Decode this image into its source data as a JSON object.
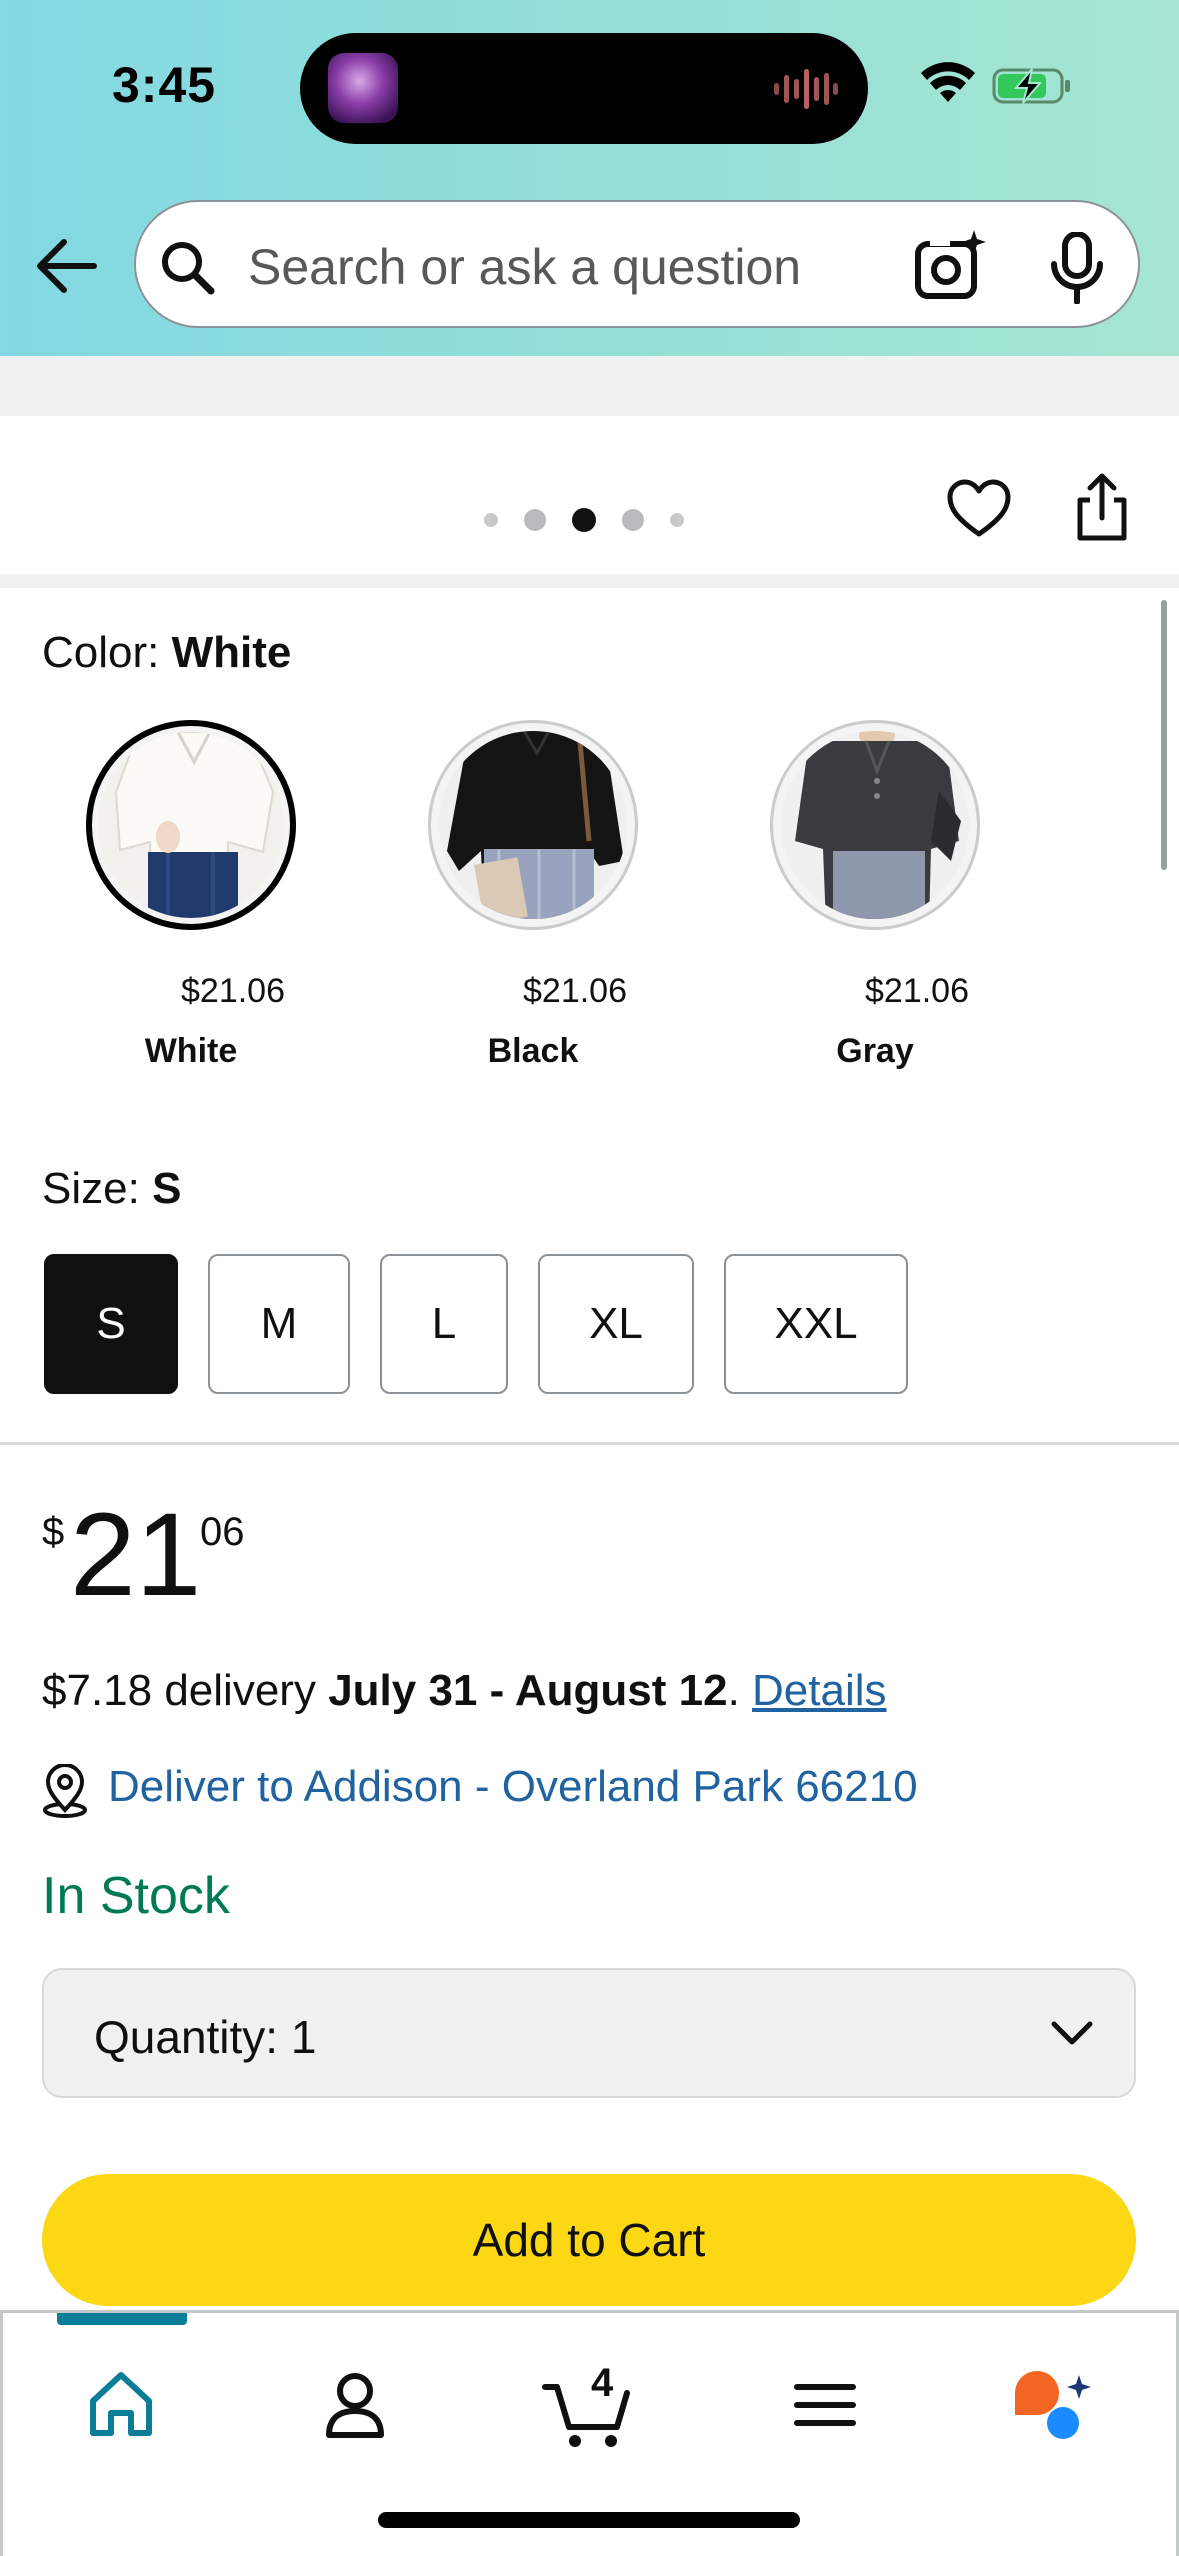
{
  "status": {
    "time": "3:45"
  },
  "search": {
    "placeholder": "Search or ask a question"
  },
  "gallery": {
    "dot_count": 5,
    "active_dot": 3
  },
  "color": {
    "label": "Color:",
    "selected": "White",
    "options": [
      {
        "price": "$21.06",
        "name": "White"
      },
      {
        "price": "$21.06",
        "name": "Black"
      },
      {
        "price": "$21.06",
        "name": "Gray"
      }
    ]
  },
  "size": {
    "label": "Size:",
    "selected": "S",
    "options": [
      "S",
      "M",
      "L",
      "XL",
      "XXL"
    ]
  },
  "price": {
    "symbol": "$",
    "whole": "21",
    "fraction": "06"
  },
  "delivery": {
    "fee_text": "$7.18 delivery",
    "dates": "July 31 - August 12",
    "after_dates": ".",
    "details_link": "Details",
    "deliver_to": "Deliver to Addison - Overland Park 66210"
  },
  "stock": {
    "status": "In Stock"
  },
  "quantity": {
    "label": "Quantity:",
    "value": "1"
  },
  "buttons": {
    "add_to_cart": "Add to Cart"
  },
  "cart": {
    "count": "4"
  },
  "colors": {
    "accent_teal": "#0a7d99",
    "add_to_cart_yellow": "#fcd713",
    "link_blue": "#2162a1",
    "in_stock_green": "#007a55"
  }
}
